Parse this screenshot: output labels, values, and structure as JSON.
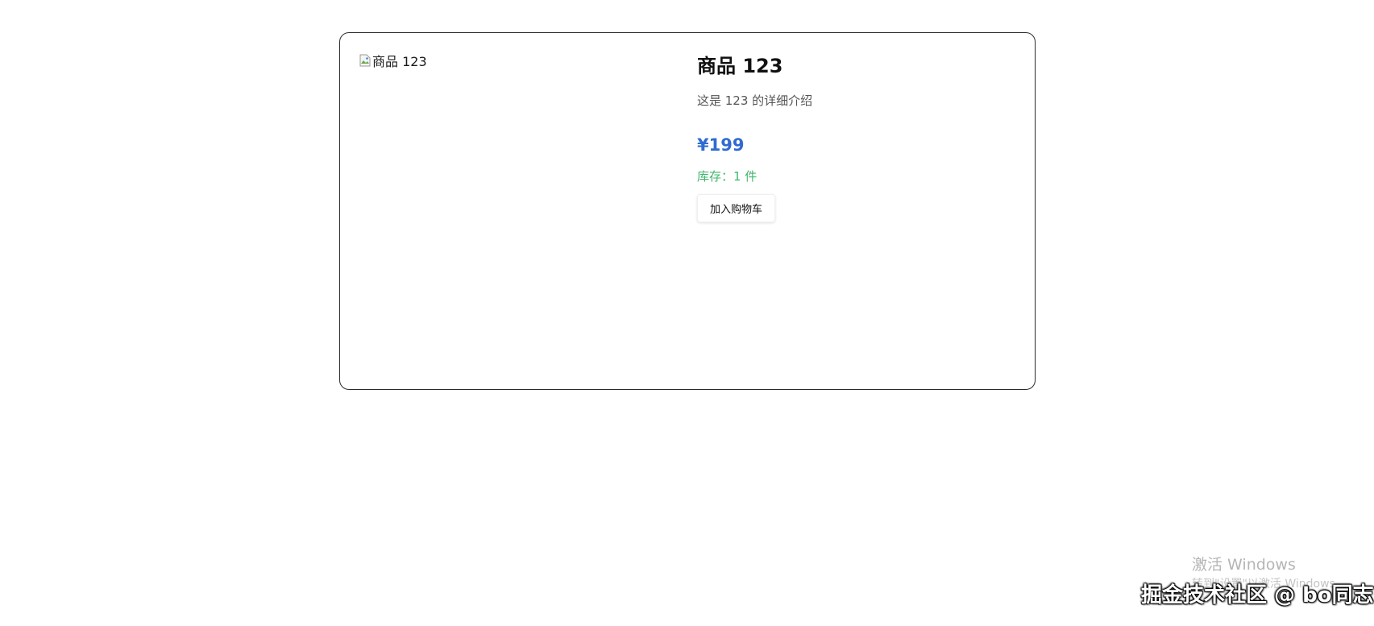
{
  "product": {
    "image_alt": "商品 123",
    "title": "商品 123",
    "description": "这是 123 的详细介绍",
    "price": "¥199",
    "stock": "库存：1 件",
    "add_to_cart_label": "加入购物车"
  },
  "watermarks": {
    "activate_title": "激活 Windows",
    "activate_sub": "转到\"设置\"以激活 Windows。",
    "juejin": "掘金技术社区 @ bo同志"
  },
  "colors": {
    "price": "#2f6bd1",
    "stock": "#3fb66a",
    "card_border": "#2b2b2b"
  },
  "icons": {
    "image_placeholder": "broken-image-icon"
  }
}
